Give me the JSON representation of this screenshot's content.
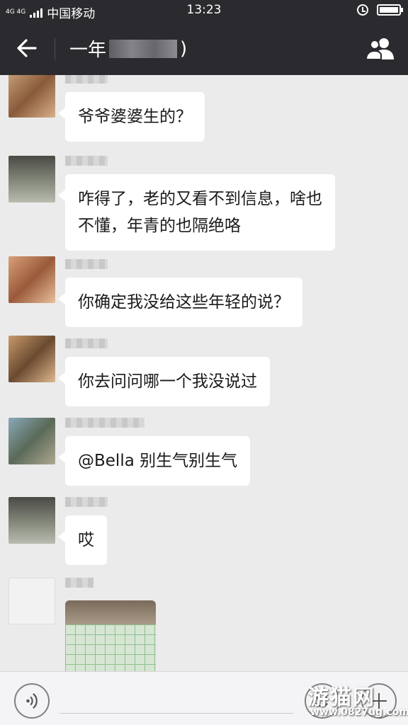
{
  "status_bar": {
    "network": "4G 4G",
    "carrier": "中国移动",
    "time": "13:23"
  },
  "header": {
    "title_prefix": "一年",
    "title_suffix": ")"
  },
  "messages": [
    {
      "text": "爷爷婆婆生的？"
    },
    {
      "text": "咋得了，老的又看不到信息，啥也\n不懂，年青的也隔绝咯"
    },
    {
      "text": "你确定我没给这些年轻的说？"
    },
    {
      "text": "你去问问哪一个我没说过"
    },
    {
      "text": "@Bella 别生气别生气"
    },
    {
      "text": "哎"
    }
  ],
  "watermark": {
    "main": "游猫网",
    "sub": "www.0827ug.com"
  },
  "colors": {
    "header_bg": "#2b2b2f",
    "chat_bg": "#ebebeb",
    "bubble_bg": "#ffffff"
  }
}
